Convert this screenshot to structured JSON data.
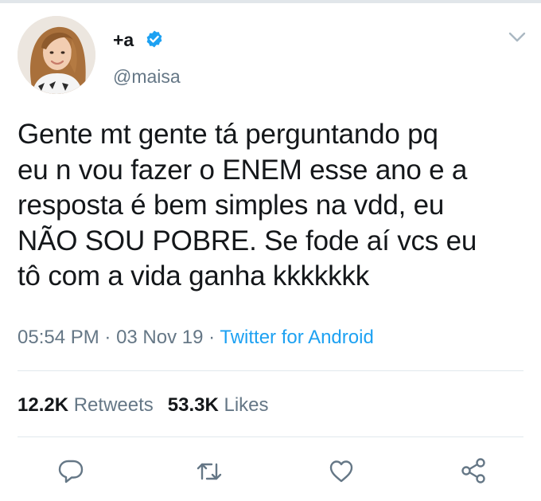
{
  "user": {
    "display_name": "+a",
    "handle": "@maisa",
    "verified": true,
    "avatar_icon": "profile-photo-avatar"
  },
  "tweet": {
    "text_lines": [
      "Gente mt gente tá perguntando pq",
      "eu n vou fazer o ENEM esse ano e a",
      "resposta é bem simples na vdd, eu",
      "NÃO SOU POBRE. Se fode aí vcs eu",
      "tô com a vida ganha kkkkkkk"
    ],
    "time": "05:54 PM",
    "separator": " · ",
    "date": "03 Nov 19",
    "source": "Twitter for Android"
  },
  "stats": {
    "retweets_count": "12.2K",
    "retweets_label": "Retweets",
    "likes_count": "53.3K",
    "likes_label": "Likes"
  },
  "actions": [
    "reply-icon",
    "retweet-icon",
    "like-icon",
    "share-icon"
  ],
  "colors": {
    "text": "#14171a",
    "secondary": "#657786",
    "accent": "#1da1f2",
    "divider": "#e1e8ed"
  }
}
